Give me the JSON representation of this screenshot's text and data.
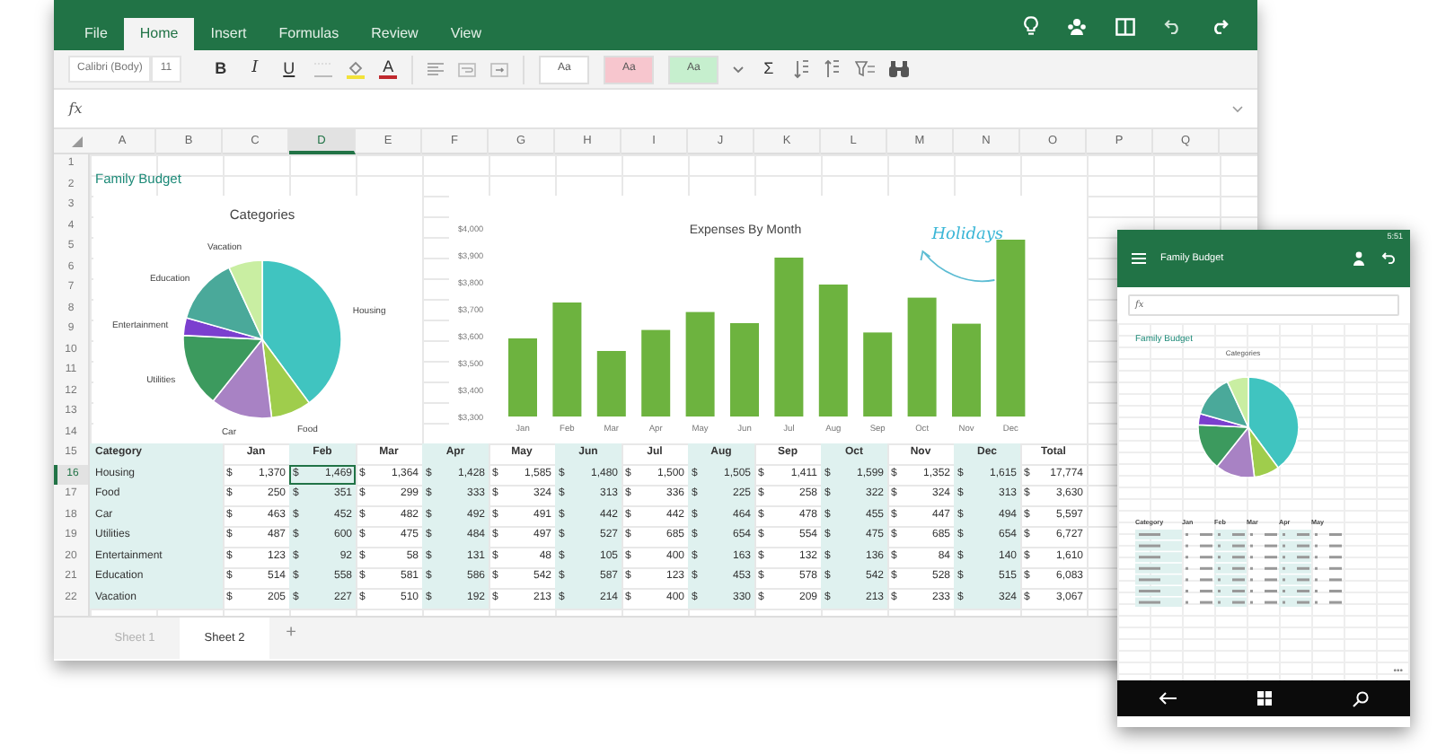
{
  "ribbon_tabs": [
    {
      "label": "File",
      "selected": false
    },
    {
      "label": "Home",
      "selected": true
    },
    {
      "label": "Insert",
      "selected": false
    },
    {
      "label": "Formulas",
      "selected": false
    },
    {
      "label": "Review",
      "selected": false
    },
    {
      "label": "View",
      "selected": false
    }
  ],
  "ribbon": {
    "font_name": "Calibri (Body)",
    "font_size": "11",
    "bold": "B",
    "italic": "I",
    "underline": "U",
    "font_color": "A",
    "autosum": "Σ",
    "cell_styles": [
      {
        "label": "Aa",
        "color": "#ffffff"
      },
      {
        "label": "Aa",
        "color": "#f7c6ce"
      },
      {
        "label": "Aa",
        "color": "#c6efce"
      }
    ]
  },
  "formula_bar": {
    "label": "fx"
  },
  "column_headers": [
    {
      "label": "A",
      "selected": false
    },
    {
      "label": "B",
      "selected": false
    },
    {
      "label": "C",
      "selected": false
    },
    {
      "label": "D",
      "selected": true
    },
    {
      "label": "E",
      "selected": false
    },
    {
      "label": "F",
      "selected": false
    },
    {
      "label": "G",
      "selected": false
    },
    {
      "label": "H",
      "selected": false
    },
    {
      "label": "I",
      "selected": false
    },
    {
      "label": "J",
      "selected": false
    },
    {
      "label": "K",
      "selected": false
    },
    {
      "label": "L",
      "selected": false
    },
    {
      "label": "M",
      "selected": false
    },
    {
      "label": "N",
      "selected": false
    },
    {
      "label": "O",
      "selected": false
    },
    {
      "label": "P",
      "selected": false
    },
    {
      "label": "Q",
      "selected": false
    }
  ],
  "row_headers": [
    {
      "label": "1",
      "selected": false
    },
    {
      "label": "2",
      "selected": false
    },
    {
      "label": "3",
      "selected": false
    },
    {
      "label": "4",
      "selected": false
    },
    {
      "label": "5",
      "selected": false
    },
    {
      "label": "6",
      "selected": false
    },
    {
      "label": "7",
      "selected": false
    },
    {
      "label": "8",
      "selected": false
    },
    {
      "label": "9",
      "selected": false
    },
    {
      "label": "10",
      "selected": false
    },
    {
      "label": "11",
      "selected": false
    },
    {
      "label": "12",
      "selected": false
    },
    {
      "label": "13",
      "selected": false
    },
    {
      "label": "14",
      "selected": false
    },
    {
      "label": "15",
      "selected": false
    },
    {
      "label": "16",
      "selected": true
    },
    {
      "label": "17",
      "selected": false
    },
    {
      "label": "18",
      "selected": false
    },
    {
      "label": "19",
      "selected": false
    },
    {
      "label": "20",
      "selected": false
    },
    {
      "label": "21",
      "selected": false
    },
    {
      "label": "22",
      "selected": false
    }
  ],
  "sheet_title": "Family Budget",
  "pie_chart": {
    "chart_data": {
      "type": "pie",
      "title": "Categories",
      "categories": [
        "Housing",
        "Food",
        "Car",
        "Utilities",
        "Entertainment",
        "Education",
        "Vacation"
      ],
      "values": [
        39.9,
        8.2,
        12.6,
        15.1,
        3.6,
        13.7,
        6.9
      ]
    }
  },
  "bar_chart": {
    "chart_data": {
      "type": "bar",
      "title": "Expenses By Month",
      "categories": [
        "Jan",
        "Feb",
        "Mar",
        "Apr",
        "May",
        "Jun",
        "Jul",
        "Aug",
        "Sep",
        "Oct",
        "Nov",
        "Dec"
      ],
      "values": [
        3590,
        3723,
        3543,
        3621,
        3688,
        3647,
        3890,
        3790,
        3612,
        3741,
        3645,
        3957
      ],
      "ylim": [
        3300,
        4000
      ],
      "yticks": [
        {
          "value": 4000,
          "label": "$4,000"
        },
        {
          "value": 3900,
          "label": "$3,900"
        },
        {
          "value": 3800,
          "label": "$3,800"
        },
        {
          "value": 3700,
          "label": "$3,700"
        },
        {
          "value": 3600,
          "label": "$3,600"
        },
        {
          "value": 3500,
          "label": "$3,500"
        },
        {
          "value": 3400,
          "label": "$3,400"
        },
        {
          "value": 3300,
          "label": "$3,300"
        }
      ],
      "annotations": [
        {
          "text": "Holidays",
          "x": "Dec"
        }
      ]
    }
  },
  "budget_table": {
    "columns": [
      "Category",
      "Jan",
      "Feb",
      "Mar",
      "Apr",
      "May",
      "Jun",
      "Jul",
      "Aug",
      "Sep",
      "Oct",
      "Nov",
      "Dec",
      "Total"
    ],
    "rows": [
      {
        "cells": [
          {
            "value": "Housing",
            "selected": false
          },
          {
            "unit": "$",
            "value": "1,370",
            "selected": false
          },
          {
            "unit": "$",
            "value": "1,469",
            "selected": true
          },
          {
            "unit": "$",
            "value": "1,364",
            "selected": false
          },
          {
            "unit": "$",
            "value": "1,428",
            "selected": false
          },
          {
            "unit": "$",
            "value": "1,585",
            "selected": false
          },
          {
            "unit": "$",
            "value": "1,480",
            "selected": false
          },
          {
            "unit": "$",
            "value": "1,500",
            "selected": false
          },
          {
            "unit": "$",
            "value": "1,505",
            "selected": false
          },
          {
            "unit": "$",
            "value": "1,411",
            "selected": false
          },
          {
            "unit": "$",
            "value": "1,599",
            "selected": false
          },
          {
            "unit": "$",
            "value": "1,352",
            "selected": false
          },
          {
            "unit": "$",
            "value": "1,615",
            "selected": false
          },
          {
            "unit": "$",
            "value": "17,774",
            "selected": false
          }
        ]
      },
      {
        "cells": [
          {
            "value": "Food",
            "selected": false
          },
          {
            "unit": "$",
            "value": "250",
            "selected": false
          },
          {
            "unit": "$",
            "value": "351",
            "selected": false
          },
          {
            "unit": "$",
            "value": "299",
            "selected": false
          },
          {
            "unit": "$",
            "value": "333",
            "selected": false
          },
          {
            "unit": "$",
            "value": "324",
            "selected": false
          },
          {
            "unit": "$",
            "value": "313",
            "selected": false
          },
          {
            "unit": "$",
            "value": "336",
            "selected": false
          },
          {
            "unit": "$",
            "value": "225",
            "selected": false
          },
          {
            "unit": "$",
            "value": "258",
            "selected": false
          },
          {
            "unit": "$",
            "value": "322",
            "selected": false
          },
          {
            "unit": "$",
            "value": "324",
            "selected": false
          },
          {
            "unit": "$",
            "value": "313",
            "selected": false
          },
          {
            "unit": "$",
            "value": "3,630",
            "selected": false
          }
        ]
      },
      {
        "cells": [
          {
            "value": "Car",
            "selected": false
          },
          {
            "unit": "$",
            "value": "463",
            "selected": false
          },
          {
            "unit": "$",
            "value": "452",
            "selected": false
          },
          {
            "unit": "$",
            "value": "482",
            "selected": false
          },
          {
            "unit": "$",
            "value": "492",
            "selected": false
          },
          {
            "unit": "$",
            "value": "491",
            "selected": false
          },
          {
            "unit": "$",
            "value": "442",
            "selected": false
          },
          {
            "unit": "$",
            "value": "442",
            "selected": false
          },
          {
            "unit": "$",
            "value": "464",
            "selected": false
          },
          {
            "unit": "$",
            "value": "478",
            "selected": false
          },
          {
            "unit": "$",
            "value": "455",
            "selected": false
          },
          {
            "unit": "$",
            "value": "447",
            "selected": false
          },
          {
            "unit": "$",
            "value": "494",
            "selected": false
          },
          {
            "unit": "$",
            "value": "5,597",
            "selected": false
          }
        ]
      },
      {
        "cells": [
          {
            "value": "Utilities",
            "selected": false
          },
          {
            "unit": "$",
            "value": "487",
            "selected": false
          },
          {
            "unit": "$",
            "value": "600",
            "selected": false
          },
          {
            "unit": "$",
            "value": "475",
            "selected": false
          },
          {
            "unit": "$",
            "value": "484",
            "selected": false
          },
          {
            "unit": "$",
            "value": "497",
            "selected": false
          },
          {
            "unit": "$",
            "value": "527",
            "selected": false
          },
          {
            "unit": "$",
            "value": "685",
            "selected": false
          },
          {
            "unit": "$",
            "value": "654",
            "selected": false
          },
          {
            "unit": "$",
            "value": "554",
            "selected": false
          },
          {
            "unit": "$",
            "value": "475",
            "selected": false
          },
          {
            "unit": "$",
            "value": "685",
            "selected": false
          },
          {
            "unit": "$",
            "value": "654",
            "selected": false
          },
          {
            "unit": "$",
            "value": "6,727",
            "selected": false
          }
        ]
      },
      {
        "cells": [
          {
            "value": "Entertainment",
            "selected": false
          },
          {
            "unit": "$",
            "value": "123",
            "selected": false
          },
          {
            "unit": "$",
            "value": "92",
            "selected": false
          },
          {
            "unit": "$",
            "value": "58",
            "selected": false
          },
          {
            "unit": "$",
            "value": "131",
            "selected": false
          },
          {
            "unit": "$",
            "value": "48",
            "selected": false
          },
          {
            "unit": "$",
            "value": "105",
            "selected": false
          },
          {
            "unit": "$",
            "value": "400",
            "selected": false
          },
          {
            "unit": "$",
            "value": "163",
            "selected": false
          },
          {
            "unit": "$",
            "value": "132",
            "selected": false
          },
          {
            "unit": "$",
            "value": "136",
            "selected": false
          },
          {
            "unit": "$",
            "value": "84",
            "selected": false
          },
          {
            "unit": "$",
            "value": "140",
            "selected": false
          },
          {
            "unit": "$",
            "value": "1,610",
            "selected": false
          }
        ]
      },
      {
        "cells": [
          {
            "value": "Education",
            "selected": false
          },
          {
            "unit": "$",
            "value": "514",
            "selected": false
          },
          {
            "unit": "$",
            "value": "558",
            "selected": false
          },
          {
            "unit": "$",
            "value": "581",
            "selected": false
          },
          {
            "unit": "$",
            "value": "586",
            "selected": false
          },
          {
            "unit": "$",
            "value": "542",
            "selected": false
          },
          {
            "unit": "$",
            "value": "587",
            "selected": false
          },
          {
            "unit": "$",
            "value": "123",
            "selected": false
          },
          {
            "unit": "$",
            "value": "453",
            "selected": false
          },
          {
            "unit": "$",
            "value": "578",
            "selected": false
          },
          {
            "unit": "$",
            "value": "542",
            "selected": false
          },
          {
            "unit": "$",
            "value": "528",
            "selected": false
          },
          {
            "unit": "$",
            "value": "515",
            "selected": false
          },
          {
            "unit": "$",
            "value": "6,083",
            "selected": false
          }
        ]
      },
      {
        "cells": [
          {
            "value": "Vacation",
            "selected": false
          },
          {
            "unit": "$",
            "value": "205",
            "selected": false
          },
          {
            "unit": "$",
            "value": "227",
            "selected": false
          },
          {
            "unit": "$",
            "value": "510",
            "selected": false
          },
          {
            "unit": "$",
            "value": "192",
            "selected": false
          },
          {
            "unit": "$",
            "value": "213",
            "selected": false
          },
          {
            "unit": "$",
            "value": "214",
            "selected": false
          },
          {
            "unit": "$",
            "value": "400",
            "selected": false
          },
          {
            "unit": "$",
            "value": "330",
            "selected": false
          },
          {
            "unit": "$",
            "value": "209",
            "selected": false
          },
          {
            "unit": "$",
            "value": "213",
            "selected": false
          },
          {
            "unit": "$",
            "value": "233",
            "selected": false
          },
          {
            "unit": "$",
            "value": "324",
            "selected": false
          },
          {
            "unit": "$",
            "value": "3,067",
            "selected": false
          }
        ]
      }
    ]
  },
  "sheet_tabs": [
    {
      "label": "Sheet 1",
      "selected": false
    },
    {
      "label": "Sheet 2",
      "selected": true
    }
  ],
  "add_sheet": "+",
  "phone": {
    "time": "5:51",
    "title": "Family Budget",
    "formula_label": "fx",
    "sheet_title": "Family Budget",
    "chart_title": "Categories",
    "table_headers": [
      "Category",
      "Jan",
      "Feb",
      "Mar",
      "Apr",
      "May"
    ],
    "more": "•••"
  }
}
